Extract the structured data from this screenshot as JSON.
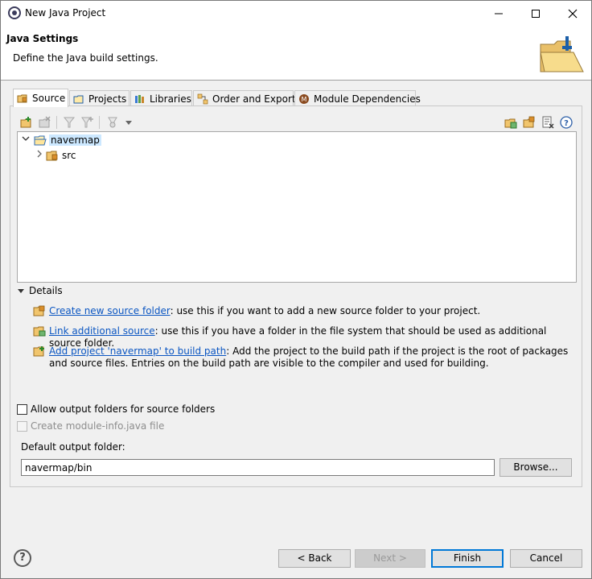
{
  "window": {
    "title": "New Java Project"
  },
  "banner": {
    "title": "Java Settings",
    "description": "Define the Java build settings."
  },
  "tabs": [
    {
      "label": "Source",
      "icon": "source-folder-icon"
    },
    {
      "label": "Projects",
      "icon": "projects-icon"
    },
    {
      "label": "Libraries",
      "icon": "libraries-icon"
    },
    {
      "label": "Order and Export",
      "icon": "order-export-icon"
    },
    {
      "label": "Module Dependencies",
      "icon": "module-icon"
    }
  ],
  "tree": {
    "root": "navermap",
    "children": [
      "src"
    ]
  },
  "details": {
    "label": "Details",
    "items": [
      {
        "link": "Create new source folder",
        "text": ": use this if you want to add a new source folder to your project."
      },
      {
        "link": "Link additional source",
        "text": ": use this if you have a folder in the file system that should be used as additional source folder."
      },
      {
        "link": "Add project 'navermap' to build path",
        "text": ": Add the project to the build path if the project is the root of packages and source files. Entries on the build path are visible to the compiler and used for building."
      }
    ]
  },
  "options": {
    "allow_output": "Allow output folders for source folders",
    "create_module_info": "Create module-info.java file"
  },
  "output": {
    "label": "Default output folder:",
    "value": "navermap/bin",
    "browse_label": "Browse..."
  },
  "buttons": {
    "help": "?",
    "back": "< Back",
    "next": "Next >",
    "finish": "Finish",
    "cancel": "Cancel"
  },
  "colors": {
    "link": "#0b56c2",
    "selection": "#cce8ff",
    "default_button_border": "#0078d7"
  }
}
